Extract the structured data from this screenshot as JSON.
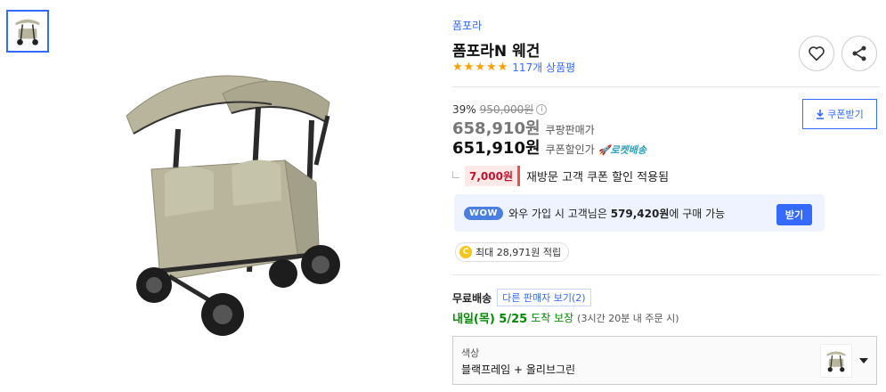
{
  "thumbnails": [
    {
      "icon": "stroller-wagon-thumbnail",
      "selected": true
    }
  ],
  "product": {
    "brand": "폼포라",
    "title": "폼포라N 웨건",
    "rating_stars": 5,
    "review_count": "117개 상품평"
  },
  "pricing": {
    "discount_rate": "39%",
    "original_price": "950,000원",
    "sale_price": "658,910원",
    "sale_label": "쿠팡판매가",
    "coupon_price": "651,910원",
    "coupon_label": "쿠폰할인가",
    "rocket_label": "로켓배송",
    "coupon_button": "쿠폰받기"
  },
  "revisit": {
    "amount": "7,000원",
    "text": "재방문 고객 쿠폰 할인 적용됨"
  },
  "wow": {
    "badge": "WOW",
    "text_prefix": "와우 가입 시 고객님은 ",
    "price": "579,420원",
    "text_suffix": "에 구매 가능",
    "button": "받기"
  },
  "points": {
    "coin": "C",
    "text": "최대 28,971원 적립"
  },
  "shipping": {
    "label": "무료배송",
    "other_sellers": "다른 판매자 보기(2)",
    "arrival_day": "내일(목) 5/25",
    "arrival_suffix": "도착 보장",
    "arrival_note": "(3시간 20분 내 주문 시)"
  },
  "option": {
    "label": "색상",
    "value": "블랙프레임 + 올리브그린"
  },
  "colors": {
    "accent": "#346aff",
    "star": "#ffa000",
    "delivery_green": "#008c00",
    "coupon_red": "#c8102e",
    "wagon_canvas": "#b8b59c",
    "wagon_frame": "#2a2a2a"
  }
}
